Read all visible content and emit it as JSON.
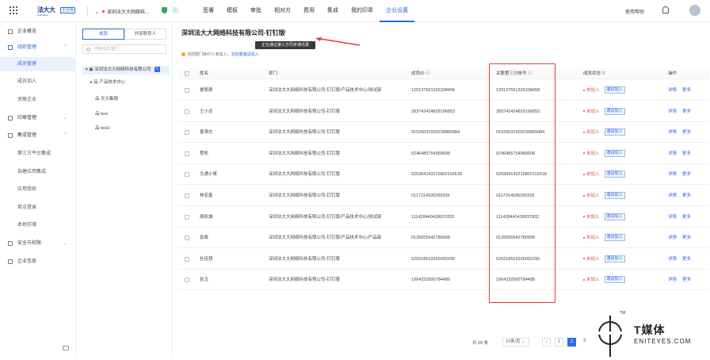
{
  "brand": {
    "name_cn": "法大大",
    "name_en": "FADADA",
    "edition": "企业版"
  },
  "header": {
    "company": "深圳法大大网络科...",
    "nav": [
      "签署",
      "模板",
      "审批",
      "相对方",
      "费用",
      "集成",
      "我的印章",
      "企业设置"
    ],
    "active_nav": "企业设置",
    "help": "使用帮助"
  },
  "sidebar": {
    "items": [
      {
        "label": "企业概览",
        "icon": "home-icon"
      },
      {
        "label": "组织管理",
        "icon": "org-icon",
        "expanded": true
      },
      {
        "label": "成员管理",
        "active": true
      },
      {
        "label": "成员加入"
      },
      {
        "label": "关联企业"
      },
      {
        "label": "印章管理",
        "icon": "seal-icon"
      },
      {
        "label": "集成管理",
        "icon": "integration-icon",
        "expanded": true
      },
      {
        "label": "第三方平台集成"
      },
      {
        "label": "自建应用集成"
      },
      {
        "label": "应用授权"
      },
      {
        "label": "单点登录"
      },
      {
        "label": "本地存储"
      },
      {
        "label": "安全与权限",
        "icon": "security-icon"
      },
      {
        "label": "企业信息",
        "icon": "info-icon"
      }
    ]
  },
  "tree": {
    "tabs": [
      "成员",
      "外部联系人"
    ],
    "search_placeholder": "搜索成员/部门",
    "root": "深圳法大大网络科技有限公司",
    "nodes": [
      "产品技术中心",
      "天元集践",
      "test",
      "test1"
    ]
  },
  "main": {
    "title": "深圳法大大网络科技有限公司-钉钉版",
    "tooltip": "正在通过第三方同步通讯录",
    "notice": "当前部门有47人未加入，",
    "notice_link": "去批量邀请加入",
    "columns": [
      "姓名",
      "部门",
      "成员ID",
      "关联第三方帐号",
      "成员状态",
      "操作"
    ],
    "rows": [
      {
        "name": "娄郁泉",
        "dept": "深圳法大大网络科技有限公司-钉钉版/产品技术中心/测试部",
        "id": "1201375613263384​58",
        "third": "1201375613263384​58"
      },
      {
        "name": "王小龙",
        "dept": "深圳法大大网络科技有限公司-钉钉版",
        "id": "28374242482919​6853",
        "third": "28374242482919​6853"
      },
      {
        "name": "夏津志",
        "dept": "深圳法大大网络科技有限公司-钉钉版",
        "id": "0152003150023986​5084",
        "third": "0152003150023986​5084"
      },
      {
        "name": "程凯",
        "dept": "深圳法大大网络科技有限公司-钉钉版",
        "id": "0246485754989508",
        "third": "0246485754989508"
      },
      {
        "name": "文通小哥",
        "dept": "深圳法大大网络科技有限公司-钉钉版",
        "id": "02036414321580211​6518",
        "third": "02036414321580211​6518"
      },
      {
        "name": "林宏鑫",
        "dept": "深圳法大大网络科技有限公司-钉钉版",
        "id": "0117314926266535",
        "third": "0117314926266535"
      },
      {
        "name": "周松城",
        "dept": "深圳法大大网络科技有限公司-钉钉版/产品技术中心/测试部",
        "id": "1114284404389378​32",
        "third": "1114284404389378​32"
      },
      {
        "name": "张政",
        "dept": "深圳法大大网络科技有限公司-钉钉版/产品技术中心/产品部",
        "id": "0126655542780908",
        "third": "0126655542780908"
      },
      {
        "name": "杜佳慧",
        "dept": "深圳法大大网络科技有限公司-钉钉版",
        "id": "5202185233260922​90",
        "third": "5202185233260922​90"
      },
      {
        "name": "张玉",
        "dept": "深圳法大大网络科技有限公司-钉钉版",
        "id": "196433290078448​9",
        "third": "196433290078448​9"
      }
    ],
    "status": "未加入",
    "invite": "邀请加入",
    "actions": [
      "详情",
      "更多"
    ]
  },
  "pager": {
    "total": "共 60 条",
    "size": "10条/页",
    "pages": [
      "1",
      "2",
      "3"
    ],
    "current": "2"
  },
  "watermark": {
    "cn": "T媒体",
    "en": "ENITEYES.COM",
    "tm": "TM"
  },
  "colors": {
    "accent": "#2d6cdf",
    "highlight_box": "#e53b3b"
  }
}
